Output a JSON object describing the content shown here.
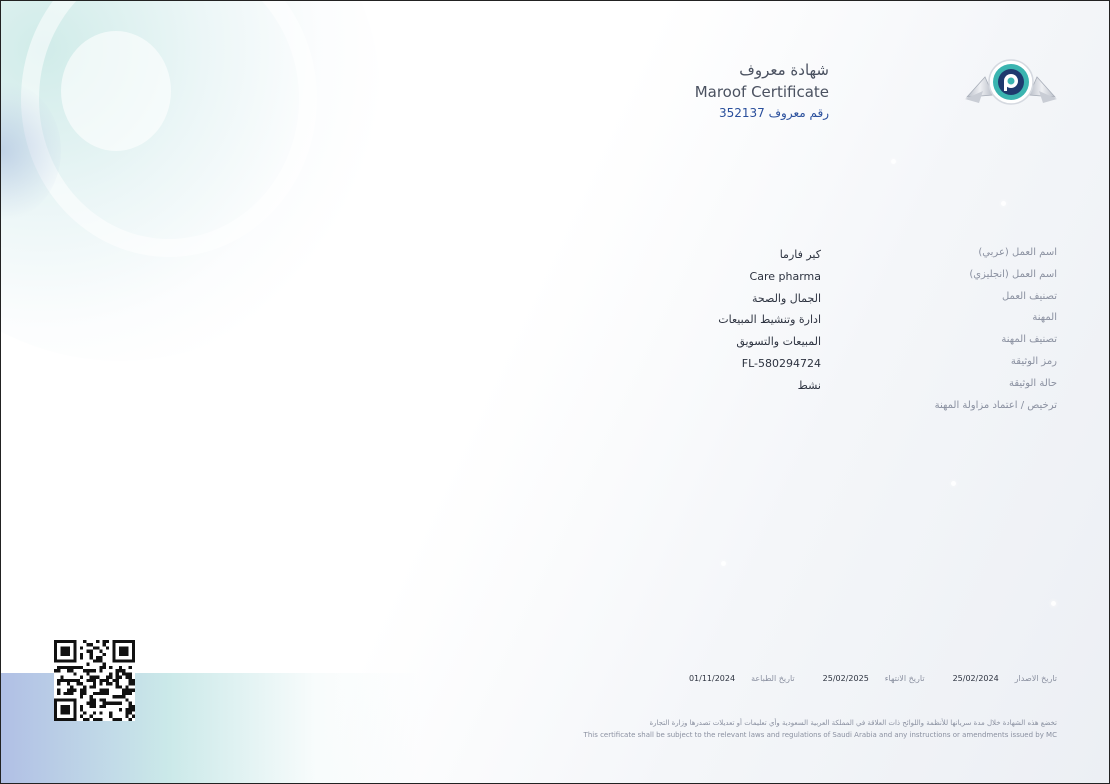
{
  "certificate": {
    "title_ar": "شهادة معروف",
    "title_en": "Maroof Certificate",
    "number_label": "رقم معروف",
    "number": "352137"
  },
  "details": {
    "labels": [
      "اسم العمل (عربي)",
      "اسم العمل (انجليزي)",
      "تصنيف العمل",
      "المهنة",
      "تصنيف المهنة",
      "رمز الوثيقة",
      "حالة الوثيقة",
      "ترخيص / اعتماد مزاولة المهنة"
    ],
    "values": [
      "كير فارما",
      "Care pharma",
      "الجمال والصحة",
      "ادارة وتنشيط المبيعات",
      "المبيعات والتسويق",
      "FL-580294724",
      "نشط"
    ]
  },
  "dates": {
    "issue_label": "تاريخ الاصدار",
    "issue_value": "25/02/2024",
    "expiry_label": "تاريخ الانتهاء",
    "expiry_value": "25/02/2025",
    "print_label": "تاريخ الطباعة",
    "print_value": "01/11/2024"
  },
  "footer": {
    "ar": "تخضع هذه الشهادة خلال مدة سريانها للأنظمة واللوائح ذات العلاقة في المملكة العربية السعودية وأي تعليمات أو تعديلات تصدرها وزارة التجارة",
    "en": "This certificate shall be subject to the relevant laws and regulations of Saudi Arabia and any instructions or amendments issued by MC"
  },
  "colors": {
    "accent": "#2a4f9c",
    "logo_teal": "#3bb4b0",
    "logo_navy": "#1f3a6e"
  },
  "icons": {
    "logo": "maroof-logo-icon",
    "qr": "qr-code-icon"
  }
}
